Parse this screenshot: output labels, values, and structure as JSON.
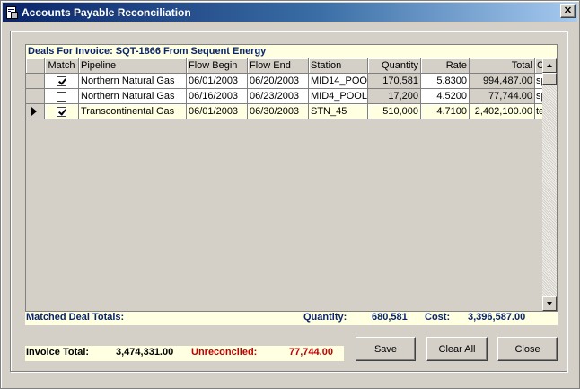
{
  "window": {
    "title": "Accounts Payable Reconciliation",
    "close_glyph": "✕"
  },
  "grid": {
    "caption": "Deals For Invoice: SQT-1866 From Sequent Energy",
    "columns": [
      "",
      "Match",
      "Pipeline",
      "Flow Begin",
      "Flow End",
      "Station",
      "Quantity",
      "Rate",
      "Total",
      "C"
    ],
    "rows": [
      {
        "match": true,
        "pipeline": "Northern Natural Gas",
        "flow_begin": "06/01/2003",
        "flow_end": "06/20/2003",
        "station": "MID14_POO",
        "quantity": "170,581",
        "rate": "5.8300",
        "total": "994,487.00",
        "c": "sp"
      },
      {
        "match": false,
        "pipeline": "Northern Natural Gas",
        "flow_begin": "06/16/2003",
        "flow_end": "06/23/2003",
        "station": "MID4_POOL",
        "quantity": "17,200",
        "rate": "4.5200",
        "total": "77,744.00",
        "c": "sp"
      },
      {
        "match": true,
        "pipeline": "Transcontinental Gas",
        "flow_begin": "06/01/2003",
        "flow_end": "06/30/2003",
        "station": "STN_45",
        "quantity": "510,000",
        "rate": "4.7100",
        "total": "2,402,100.00",
        "c": "te",
        "current": true
      }
    ]
  },
  "matched": {
    "label": "Matched Deal Totals:",
    "quantity_label": "Quantity:",
    "quantity": "680,581",
    "cost_label": "Cost:",
    "cost": "3,396,587.00"
  },
  "invoice": {
    "total_label": "Invoice Total:",
    "total": "3,474,331.00",
    "unreconciled_label": "Unreconciled:",
    "unreconciled": "77,744.00"
  },
  "buttons": {
    "save": "Save",
    "clear_all": "Clear All",
    "close": "Close"
  },
  "colors": {
    "caption_text": "#0a246a",
    "unreconciled": "#c00000",
    "highlight": "#ffffe1"
  }
}
